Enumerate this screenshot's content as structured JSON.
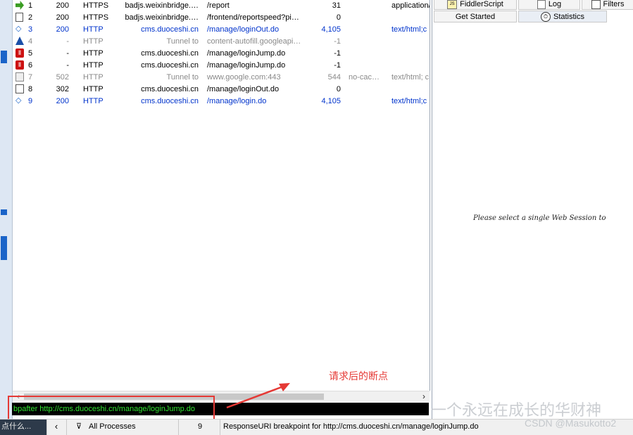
{
  "sessions": [
    {
      "icon": "green-arrow-icon",
      "num": "1",
      "result": "200",
      "protocol": "HTTPS",
      "host": "badjs.weixinbridge.…",
      "url": "/report",
      "body": "31",
      "caching": "",
      "ctype": "application/",
      "style": "normal"
    },
    {
      "icon": "document-icon",
      "num": "2",
      "result": "200",
      "protocol": "HTTPS",
      "host": "badjs.weixinbridge.…",
      "url": "/frontend/reportspeed?pi…",
      "body": "0",
      "caching": "",
      "ctype": "",
      "style": "normal"
    },
    {
      "icon": "diamond-arrows-icon",
      "num": "3",
      "result": "200",
      "protocol": "HTTP",
      "host": "cms.duoceshi.cn",
      "url": "/manage/loginOut.do",
      "body": "4,105",
      "caching": "",
      "ctype": "text/html;c",
      "style": "blue"
    },
    {
      "icon": "up-arrow-icon",
      "num": "4",
      "result": "-",
      "protocol": "HTTP",
      "host": "Tunnel to",
      "url": "content-autofill.googleapi…",
      "body": "-1",
      "caching": "",
      "ctype": "",
      "style": "gray"
    },
    {
      "icon": "breakpoint-icon",
      "num": "5",
      "result": "-",
      "protocol": "HTTP",
      "host": "cms.duoceshi.cn",
      "url": "/manage/loginJump.do",
      "body": "-1",
      "caching": "",
      "ctype": "",
      "style": "normal"
    },
    {
      "icon": "breakpoint-icon",
      "num": "6",
      "result": "-",
      "protocol": "HTTP",
      "host": "cms.duoceshi.cn",
      "url": "/manage/loginJump.do",
      "body": "-1",
      "caching": "",
      "ctype": "",
      "style": "normal"
    },
    {
      "icon": "lock-icon",
      "num": "7",
      "result": "502",
      "protocol": "HTTP",
      "host": "Tunnel to",
      "url": "www.google.com:443",
      "body": "544",
      "caching": "no-cac…",
      "ctype": "text/html; c",
      "style": "gray"
    },
    {
      "icon": "image-icon",
      "num": "8",
      "result": "302",
      "protocol": "HTTP",
      "host": "cms.duoceshi.cn",
      "url": "/manage/loginOut.do",
      "body": "0",
      "caching": "",
      "ctype": "",
      "style": "normal"
    },
    {
      "icon": "diamond-arrows-icon",
      "num": "9",
      "result": "200",
      "protocol": "HTTP",
      "host": "cms.duoceshi.cn",
      "url": "/manage/login.do",
      "body": "4,105",
      "caching": "",
      "ctype": "text/html;c",
      "style": "blue"
    }
  ],
  "tabs": {
    "fiddlerscript": "FiddlerScript",
    "log": "Log",
    "filters": "Filters",
    "get_started": "Get Started",
    "statistics": "Statistics"
  },
  "right_hint": "Please select a single Web Session to",
  "quickexec": "bpafter http://cms.duoceshi.cn/manage/loginJump.do",
  "annotation": "请求后的断点",
  "statusbar": {
    "capture": "点什么...",
    "processes": "All Processes",
    "count": "9",
    "message": "ResponseURI breakpoint for http://cms.duoceshi.cn/manage/loginJump.do"
  },
  "watermark": {
    "slogan": "一个永远在成长的华财神",
    "csdn": "CSDN @Masukotto2"
  },
  "colors": {
    "quickexec_bg": "#000000",
    "quickexec_text": "#31e331",
    "annotation": "#e53935",
    "link_blue": "#0033cc"
  }
}
